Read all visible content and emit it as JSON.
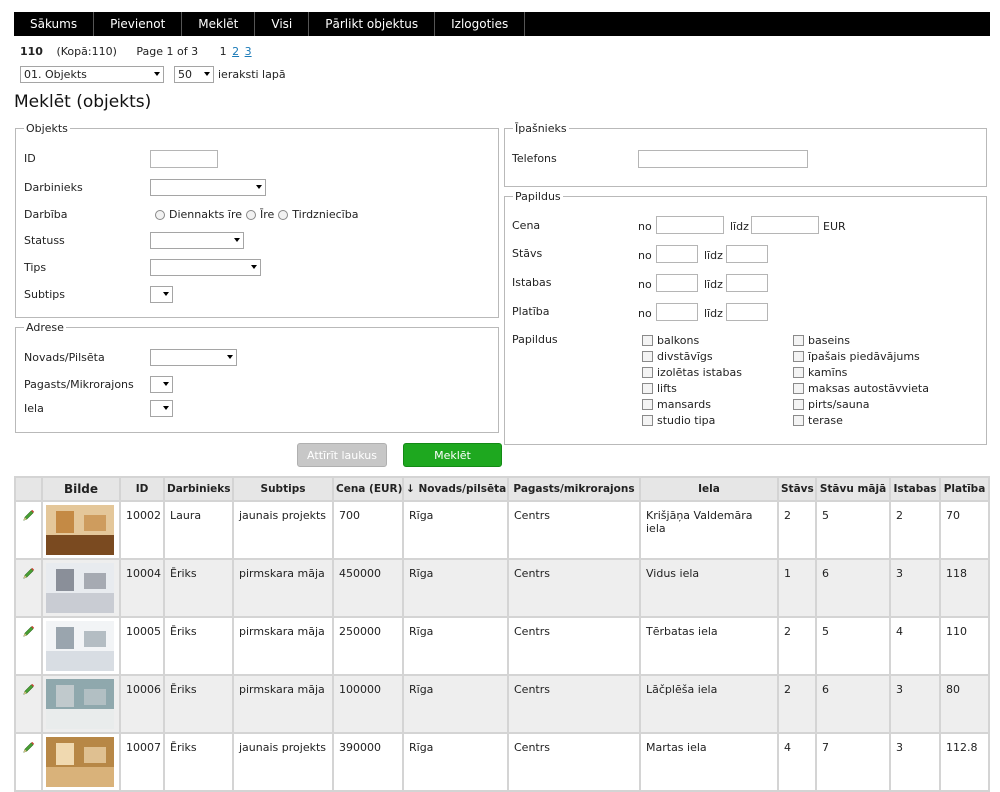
{
  "nav": {
    "items": [
      "Sākums",
      "Pievienot",
      "Meklēt",
      "Visi",
      "Pārlikt objektus",
      "Izlogoties"
    ]
  },
  "pager": {
    "total": "110",
    "total_label": "(Kopā:110)",
    "page_label": "Page 1 of 3",
    "current_page": "1",
    "page_2": "2",
    "page_3": "3"
  },
  "view": {
    "type_select": "01. Objekts",
    "per_page_select": "50",
    "per_page_suffix": "ieraksti lapā"
  },
  "title": "Meklēt (objekts)",
  "objekts": {
    "legend": "Objekts",
    "id_label": "ID",
    "darbinieks_label": "Darbinieks",
    "darbiba_label": "Darbība",
    "darbiba_options": [
      "Diennakts īre",
      "Īre",
      "Tirdzniecība"
    ],
    "statuss_label": "Statuss",
    "tips_label": "Tips",
    "subtips_label": "Subtips"
  },
  "adrese": {
    "legend": "Adrese",
    "novads_label": "Novads/Pilsēta",
    "pagasts_label": "Pagasts/Mikrorajons",
    "iela_label": "Iela"
  },
  "ipasnieks": {
    "legend": "Īpašnieks",
    "telefons_label": "Telefons"
  },
  "papildus": {
    "legend": "Papildus",
    "cena_label": "Cena",
    "stavs_label": "Stāvs",
    "istabas_label": "Istabas",
    "platiba_label": "Platība",
    "papildus_label": "Papildus",
    "no": "no",
    "lidz": "līdz",
    "currency": "EUR",
    "options_left": [
      "balkons",
      "divstāvīgs",
      "izolētas istabas",
      "lifts",
      "mansards",
      "studio tipa"
    ],
    "options_right": [
      "baseins",
      "īpašais piedāvājums",
      "kamīns",
      "maksas autostāvvieta",
      "pirts/sauna",
      "terase"
    ]
  },
  "buttons": {
    "clear": "Attīrīt laukus",
    "search": "Meklēt"
  },
  "table": {
    "headers": [
      "",
      "Bilde",
      "ID",
      "Darbinieks",
      "Subtips",
      "Cena (EUR)",
      "↓ Novads/pilsēta",
      "Pagasts/mikrorajons",
      "Iela",
      "Stāvs",
      "Stāvu mājā",
      "Istabas",
      "Platība"
    ],
    "rows": [
      {
        "id": "10002",
        "darbinieks": "Laura",
        "subtips": "jaunais projekts",
        "cena": "700",
        "novads": "Rīga",
        "pagasts": "Centrs",
        "iela": "Krišjāņa Valdemāra iela",
        "stavs": "2",
        "stavu_maja": "5",
        "istabas": "2",
        "platiba": "70",
        "photo": "interior-living-room"
      },
      {
        "id": "10004",
        "darbinieks": "Ēriks",
        "subtips": "pirmskara māja",
        "cena": "450000",
        "novads": "Rīga",
        "pagasts": "Centrs",
        "iela": "Vidus iela",
        "stavs": "1",
        "stavu_maja": "6",
        "istabas": "3",
        "platiba": "118",
        "photo": "building-facade"
      },
      {
        "id": "10005",
        "darbinieks": "Ēriks",
        "subtips": "pirmskara māja",
        "cena": "250000",
        "novads": "Rīga",
        "pagasts": "Centrs",
        "iela": "Tērbatas iela",
        "stavs": "2",
        "stavu_maja": "5",
        "istabas": "4",
        "platiba": "110",
        "photo": "empty-room-door"
      },
      {
        "id": "10006",
        "darbinieks": "Ēriks",
        "subtips": "pirmskara māja",
        "cena": "100000",
        "novads": "Rīga",
        "pagasts": "Centrs",
        "iela": "Lāčplēša iela",
        "stavs": "2",
        "stavu_maja": "6",
        "istabas": "3",
        "platiba": "80",
        "photo": "bright-room-window"
      },
      {
        "id": "10007",
        "darbinieks": "Ēriks",
        "subtips": "jaunais projekts",
        "cena": "390000",
        "novads": "Rīga",
        "pagasts": "Centrs",
        "iela": "Martas iela",
        "stavs": "4",
        "stavu_maja": "7",
        "istabas": "3",
        "platiba": "112.8",
        "photo": "warm-interior"
      }
    ]
  }
}
